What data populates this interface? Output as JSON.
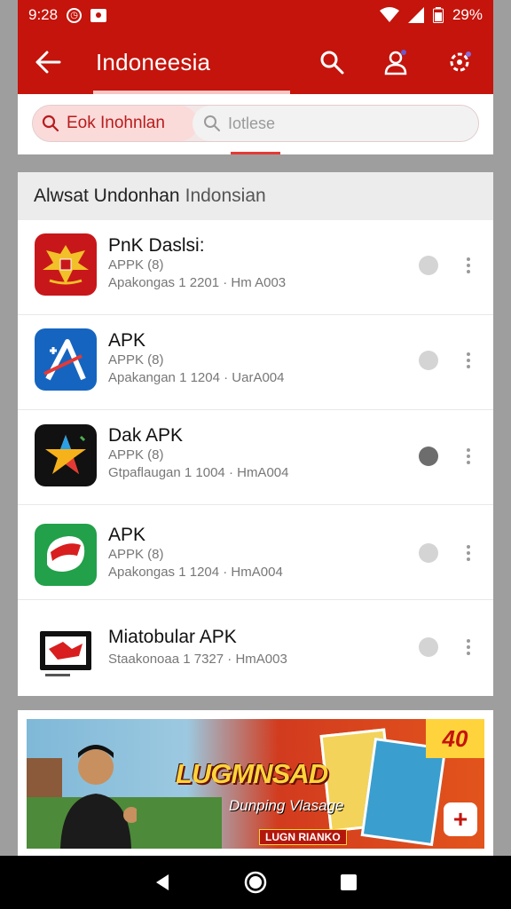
{
  "status_bar": {
    "time": "9:28",
    "battery": "29%",
    "icons": [
      "alarm-icon",
      "notification-icon",
      "wifi-icon",
      "signal-icon",
      "battery-icon"
    ]
  },
  "app_bar": {
    "title": "Indoneesia",
    "icons": [
      "back-arrow-icon",
      "search-icon",
      "profile-icon",
      "settings-icon"
    ],
    "color": "#c4140c"
  },
  "search": {
    "active_value": "Eok Inohnlan",
    "secondary_placeholder": "Iotlese"
  },
  "section": {
    "title": "Alwsat Undonhan",
    "subtitle": "Indonsian"
  },
  "apps": [
    {
      "title": "PnK Daslsi:",
      "version": "APPK (8)",
      "meta": "Apakongas 1 2201 · Hm A003",
      "icon": "garuda-emblem-icon",
      "selected": false
    },
    {
      "title": "APK",
      "version": "APPK (8)",
      "meta": "Apakangan 1 1204 · UarA004",
      "icon": "a-logo-icon",
      "selected": false
    },
    {
      "title": "Dak APK",
      "version": "APPK (8)",
      "meta": "Gtpaflaugan 1 1004 · HmA004",
      "icon": "star-logo-icon",
      "selected": true
    },
    {
      "title": "APK",
      "version": "APPK (8)",
      "meta": "Apakongas 1 1204 · HmA004",
      "icon": "green-flag-icon",
      "selected": false
    },
    {
      "title": "Miatobular APK",
      "version": "",
      "meta": "Staakonoaa 1 7327 · HmA003",
      "icon": "film-frame-icon",
      "selected": false
    }
  ],
  "banner": {
    "headline": "LUGMNSAD",
    "tagline": "Dunping Vlasage",
    "sub": "LUGN RIANKO",
    "badge": "40",
    "plus": "+"
  },
  "nav": {
    "icons": [
      "back-triangle-icon",
      "home-circle-icon",
      "recents-square-icon"
    ]
  }
}
